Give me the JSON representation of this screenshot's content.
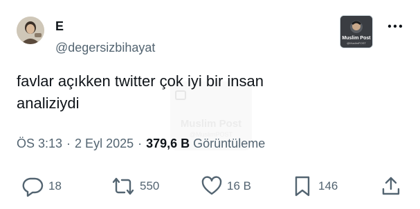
{
  "author": {
    "display_name": "E",
    "handle": "@degersizbihayat"
  },
  "badge": {
    "brand": "Muslim Post",
    "sub": "@MuslimPOST"
  },
  "tweet": {
    "text": "favlar açıkken twitter çok iyi bir insan\nanaliziydi"
  },
  "meta": {
    "time": "ÖS 3:13",
    "separator": "·",
    "date": "2 Eyl 2025",
    "views_count": "379,6 B",
    "views_label": "Görüntüleme"
  },
  "actions": {
    "replies": "18",
    "reposts": "550",
    "likes": "16 B",
    "bookmarks": "146"
  },
  "colors": {
    "text": "#0f1419",
    "secondary": "#536471",
    "background": "#ffffff"
  },
  "icons": [
    "more-icon",
    "reply-icon",
    "repost-icon",
    "like-icon",
    "bookmark-icon",
    "share-icon"
  ]
}
